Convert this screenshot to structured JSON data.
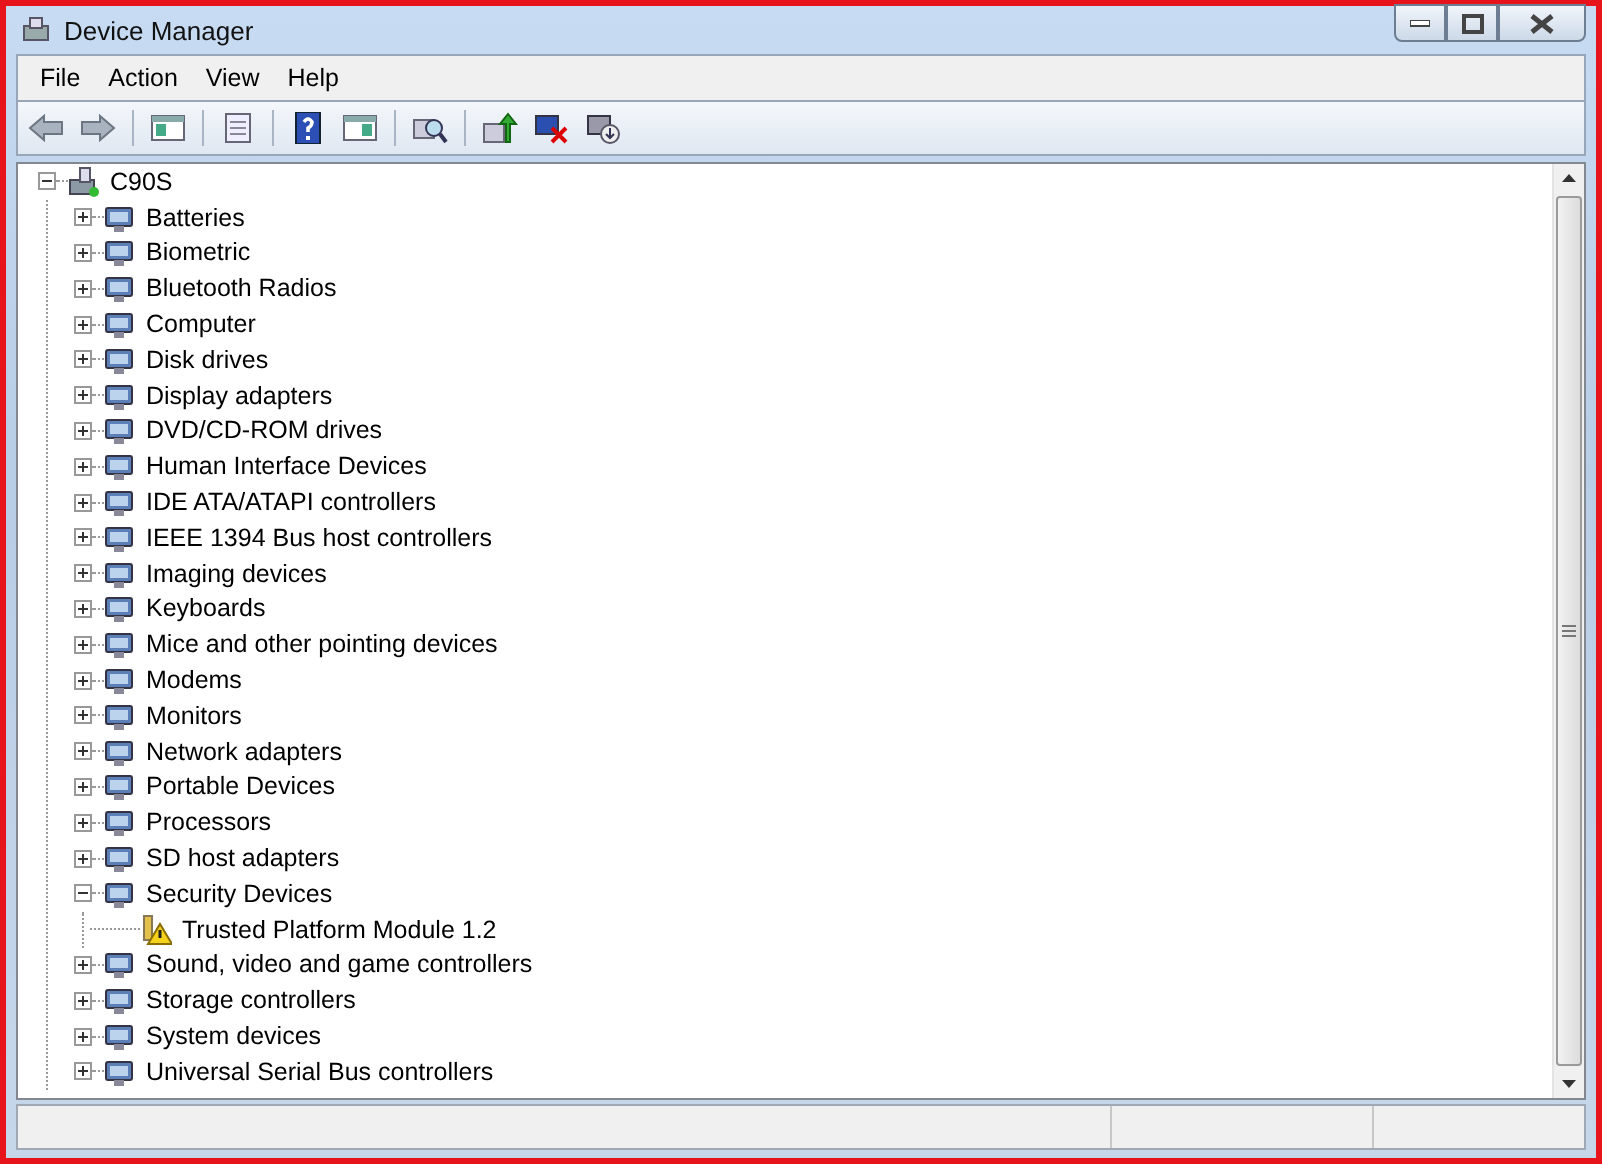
{
  "window": {
    "title": "Device Manager"
  },
  "menu": [
    "File",
    "Action",
    "View",
    "Help"
  ],
  "tree": {
    "label": "C90S",
    "expanded": true,
    "children": [
      {
        "label": "Batteries",
        "expanded": false
      },
      {
        "label": "Biometric",
        "expanded": false
      },
      {
        "label": "Bluetooth Radios",
        "expanded": false
      },
      {
        "label": "Computer",
        "expanded": false
      },
      {
        "label": "Disk drives",
        "expanded": false
      },
      {
        "label": "Display adapters",
        "expanded": false
      },
      {
        "label": "DVD/CD-ROM drives",
        "expanded": false
      },
      {
        "label": "Human Interface Devices",
        "expanded": false
      },
      {
        "label": "IDE ATA/ATAPI controllers",
        "expanded": false
      },
      {
        "label": "IEEE 1394 Bus host controllers",
        "expanded": false
      },
      {
        "label": "Imaging devices",
        "expanded": false
      },
      {
        "label": "Keyboards",
        "expanded": false
      },
      {
        "label": "Mice and other pointing devices",
        "expanded": false
      },
      {
        "label": "Modems",
        "expanded": false
      },
      {
        "label": "Monitors",
        "expanded": false
      },
      {
        "label": "Network adapters",
        "expanded": false
      },
      {
        "label": "Portable Devices",
        "expanded": false
      },
      {
        "label": "Processors",
        "expanded": false
      },
      {
        "label": "SD host adapters",
        "expanded": false
      },
      {
        "label": "Security Devices",
        "expanded": true,
        "children": [
          {
            "label": "Trusted Platform Module 1.2",
            "warning": true
          }
        ]
      },
      {
        "label": "Sound, video and game controllers",
        "expanded": false
      },
      {
        "label": "Storage controllers",
        "expanded": false
      },
      {
        "label": "System devices",
        "expanded": false
      },
      {
        "label": "Universal Serial Bus controllers",
        "expanded": false
      }
    ]
  }
}
